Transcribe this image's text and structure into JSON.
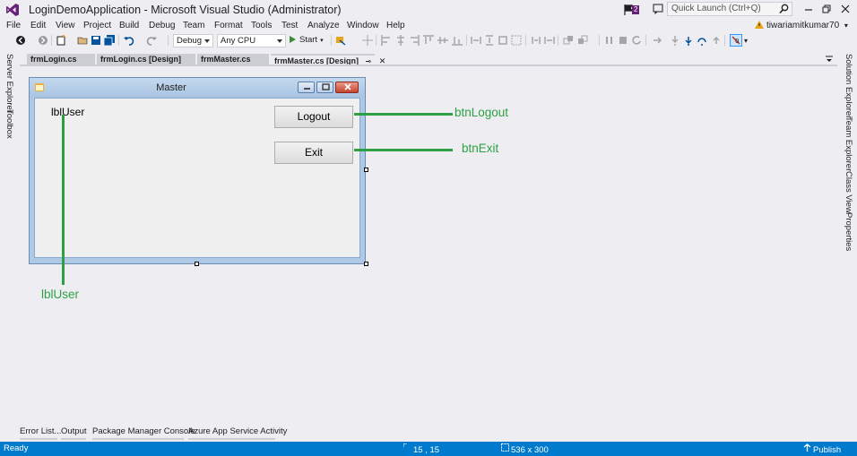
{
  "window": {
    "title": "LoginDemoApplication - Microsoft Visual Studio (Administrator)",
    "notification_count": "2",
    "quick_launch_placeholder": "Quick Launch (Ctrl+Q)",
    "user": "tiwariamitkumar70"
  },
  "menu": [
    "File",
    "Edit",
    "View",
    "Project",
    "Build",
    "Debug",
    "Team",
    "Format",
    "Tools",
    "Test",
    "Analyze",
    "Window",
    "Help"
  ],
  "toolbar": {
    "configuration": "Debug",
    "platform": "Any CPU",
    "start_label": "Start"
  },
  "left_panels": [
    "Server Explorer",
    "Toolbox"
  ],
  "right_panels": [
    "Solution Explorer",
    "Team Explorer",
    "Class View",
    "Properties"
  ],
  "doc_tabs": [
    {
      "label": "frmLogin.cs",
      "active": false
    },
    {
      "label": "frmLogin.cs [Design]",
      "active": false
    },
    {
      "label": "frmMaster.cs",
      "active": false
    },
    {
      "label": "frmMaster.cs [Design]",
      "active": true
    }
  ],
  "form": {
    "title": "Master",
    "label_user": "lblUser",
    "logout_button": "Logout",
    "exit_button": "Exit"
  },
  "annotations": {
    "btn_logout": "btnLogout",
    "btn_exit": "btnExit",
    "lbl_user": "lblUser",
    "color": "#2ea043"
  },
  "bottom_tabs": [
    "Error List...",
    "Output",
    "Package Manager Console",
    "Azure App Service Activity"
  ],
  "status": {
    "state": "Ready",
    "position": "15 , 15",
    "size": "536 x 300",
    "publish": "Publish"
  },
  "colors": {
    "accent": "#68217a",
    "statusbar": "#007acc",
    "background": "#eeeef2"
  }
}
